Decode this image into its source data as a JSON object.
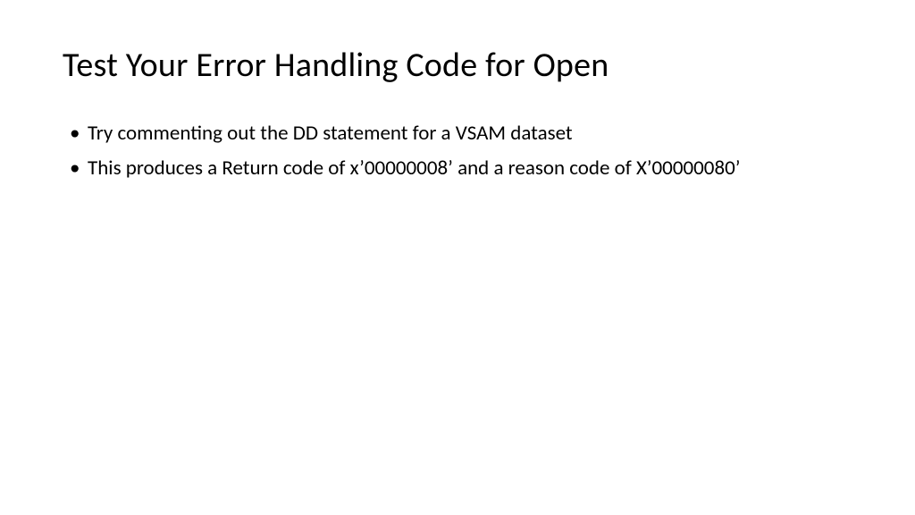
{
  "slide": {
    "title": "Test Your Error Handling Code for Open",
    "bullets": [
      "Try commenting out the DD statement for a VSAM dataset",
      "This produces a Return code of x’00000008’ and a reason code of X’00000080’"
    ]
  }
}
